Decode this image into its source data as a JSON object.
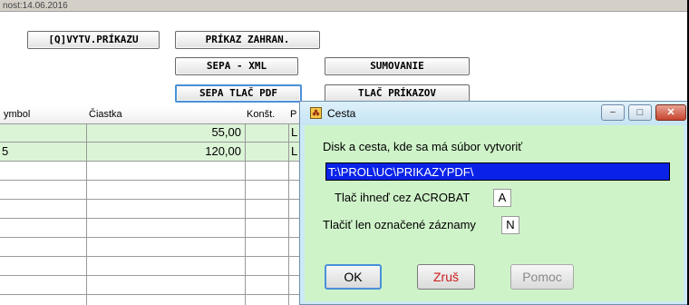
{
  "topbar": {
    "text": "nost:14.06.2016"
  },
  "toolbar": {
    "create_order": "[Q]VYTV.PRÍKAZU",
    "foreign_order": "PRÍKAZ ZAHRAN.",
    "sepa_xml": "SEPA - XML",
    "summing": "SUMOVANIE",
    "sepa_print_pdf": "SEPA TLAČ PDF",
    "print_orders": "TLAČ PRÍKAZOV"
  },
  "grid": {
    "headers": {
      "symbol": "ymbol",
      "amount": "Čiastka",
      "const": "Konšt.",
      "extra": "P"
    },
    "rows": [
      {
        "symbol": "",
        "amount": "55,00",
        "extra": "L"
      },
      {
        "symbol": "5",
        "amount": "120,00",
        "extra": "L"
      },
      {
        "symbol": "",
        "amount": "",
        "extra": ""
      },
      {
        "symbol": "",
        "amount": "",
        "extra": ""
      },
      {
        "symbol": "",
        "amount": "",
        "extra": ""
      },
      {
        "symbol": "",
        "amount": "",
        "extra": ""
      },
      {
        "symbol": "",
        "amount": "",
        "extra": ""
      },
      {
        "symbol": "",
        "amount": "",
        "extra": ""
      },
      {
        "symbol": "",
        "amount": "",
        "extra": ""
      }
    ]
  },
  "dialog": {
    "title": "Cesta",
    "path_label": "Disk a cesta, kde sa má súbor vytvoriť",
    "path_value": "T:\\PROL\\UC\\PRIKAZYPDF\\",
    "acrobat_label": "Tlač ihneď cez ACROBAT",
    "acrobat_value": "A",
    "marked_label": "Tlačiť len označené záznamy",
    "marked_value": "N",
    "ok_label": "OK",
    "cancel_label": "Zruš",
    "help_label": "Pomoc",
    "minimize_glyph": "−",
    "maximize_glyph": "□",
    "close_glyph": "✕"
  },
  "colors": {
    "dialog_bg": "#cff3c9",
    "row_highlight": "#dbf4d6",
    "selection": "#0a22e8",
    "cancel_text": "#cc1a1a"
  },
  "icons": [
    "app-icon",
    "minimize-icon",
    "maximize-icon",
    "close-icon"
  ]
}
